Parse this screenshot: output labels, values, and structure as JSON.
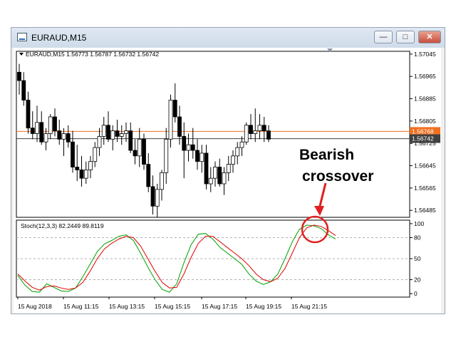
{
  "window": {
    "title": "EURAUD,M15",
    "min_glyph": "—",
    "max_glyph": "□",
    "close_glyph": "✕"
  },
  "chart_data": [
    {
      "type": "candlestick",
      "symbol_header": "EURAUD,M15  1.56773 1.56787 1.56732 1.56742",
      "ylim": [
        1.5646,
        1.57055
      ],
      "y_ticks": [
        "1.57045",
        "1.56965",
        "1.56885",
        "1.56805",
        "1.56725",
        "1.56645",
        "1.56565",
        "1.56485"
      ],
      "price_lines": [
        {
          "label": "1.56768",
          "value": 1.56768,
          "color": "#f07020"
        },
        {
          "label": "1.56742",
          "value": 1.56742,
          "color": "#404040"
        }
      ],
      "candle_colors": {
        "bull": "#ffffff",
        "bear": "#000000",
        "outline": "#000000"
      },
      "candles": [
        [
          1.5698,
          1.5701,
          1.569,
          1.5695
        ],
        [
          1.5695,
          1.5698,
          1.5686,
          1.5688
        ],
        [
          1.5688,
          1.5691,
          1.5676,
          1.5678
        ],
        [
          1.5678,
          1.5684,
          1.5674,
          1.5676
        ],
        [
          1.5676,
          1.5686,
          1.5673,
          1.568
        ],
        [
          1.568,
          1.5684,
          1.5672,
          1.5673
        ],
        [
          1.5673,
          1.5678,
          1.567,
          1.5676
        ],
        [
          1.5676,
          1.5683,
          1.5674,
          1.5682
        ],
        [
          1.5682,
          1.5685,
          1.5675,
          1.5677
        ],
        [
          1.5677,
          1.5681,
          1.5672,
          1.5674
        ],
        [
          1.5674,
          1.5678,
          1.5668,
          1.5676
        ],
        [
          1.5676,
          1.5679,
          1.5671,
          1.5673
        ],
        [
          1.5673,
          1.5677,
          1.5662,
          1.5664
        ],
        [
          1.5664,
          1.5672,
          1.5659,
          1.5663
        ],
        [
          1.5663,
          1.5668,
          1.5657,
          1.566
        ],
        [
          1.566,
          1.5666,
          1.5658,
          1.5663
        ],
        [
          1.5663,
          1.5668,
          1.566,
          1.5666
        ],
        [
          1.5666,
          1.5673,
          1.5664,
          1.5671
        ],
        [
          1.5671,
          1.5678,
          1.5668,
          1.5675
        ],
        [
          1.5675,
          1.5682,
          1.5672,
          1.5679
        ],
        [
          1.5679,
          1.5684,
          1.5673,
          1.5674
        ],
        [
          1.5674,
          1.5679,
          1.567,
          1.5677
        ],
        [
          1.5677,
          1.5681,
          1.5673,
          1.5675
        ],
        [
          1.5675,
          1.5679,
          1.5672,
          1.5676
        ],
        [
          1.5676,
          1.568,
          1.5673,
          1.5677
        ],
        [
          1.5677,
          1.568,
          1.5669,
          1.567
        ],
        [
          1.567,
          1.5674,
          1.5665,
          1.5668
        ],
        [
          1.5668,
          1.5678,
          1.5664,
          1.5674
        ],
        [
          1.5674,
          1.5676,
          1.5663,
          1.5665
        ],
        [
          1.5665,
          1.5669,
          1.5655,
          1.5657
        ],
        [
          1.5657,
          1.5661,
          1.5647,
          1.565
        ],
        [
          1.565,
          1.5658,
          1.5646,
          1.5656
        ],
        [
          1.5656,
          1.5663,
          1.5652,
          1.5662
        ],
        [
          1.5662,
          1.5678,
          1.5658,
          1.5674
        ],
        [
          1.5674,
          1.569,
          1.5671,
          1.5688
        ],
        [
          1.5688,
          1.5694,
          1.568,
          1.5682
        ],
        [
          1.5682,
          1.5686,
          1.5672,
          1.5675
        ],
        [
          1.5675,
          1.568,
          1.566,
          1.567
        ],
        [
          1.567,
          1.5676,
          1.5666,
          1.5672
        ],
        [
          1.5672,
          1.5678,
          1.5667,
          1.567
        ],
        [
          1.567,
          1.5674,
          1.5663,
          1.5666
        ],
        [
          1.5666,
          1.5672,
          1.5662,
          1.5669
        ],
        [
          1.5669,
          1.5672,
          1.5656,
          1.5658
        ],
        [
          1.5658,
          1.5664,
          1.5655,
          1.566
        ],
        [
          1.566,
          1.5666,
          1.5657,
          1.5664
        ],
        [
          1.5664,
          1.5667,
          1.5657,
          1.5658
        ],
        [
          1.5658,
          1.5664,
          1.5654,
          1.5662
        ],
        [
          1.5662,
          1.5668,
          1.5659,
          1.5665
        ],
        [
          1.5665,
          1.567,
          1.5662,
          1.5668
        ],
        [
          1.5668,
          1.5673,
          1.5665,
          1.5671
        ],
        [
          1.5671,
          1.5675,
          1.5668,
          1.5673
        ],
        [
          1.5673,
          1.568,
          1.5672,
          1.5679
        ],
        [
          1.5679,
          1.5683,
          1.5674,
          1.5676
        ],
        [
          1.5676,
          1.5685,
          1.5673,
          1.5677
        ],
        [
          1.5677,
          1.5683,
          1.5674,
          1.5679
        ],
        [
          1.5679,
          1.5682,
          1.5673,
          1.5677
        ],
        [
          1.5677,
          1.5679,
          1.5673,
          1.5674
        ]
      ],
      "annotation": [
        "Bearish",
        "crossover"
      ],
      "annotation_color": "#e02020"
    },
    {
      "type": "line",
      "title": "Stoch(12,3,3) 82.2449 89.8119",
      "ylim": [
        -5,
        105
      ],
      "y_ticks": [
        "100",
        "80",
        "50",
        "20",
        "0"
      ],
      "levels": [
        80,
        50,
        20
      ],
      "series": [
        {
          "color": "#00a000",
          "values": [
            26,
            12,
            3,
            2,
            14,
            9,
            4,
            3,
            8,
            24,
            42,
            60,
            71,
            76,
            82,
            84,
            76,
            58,
            38,
            20,
            6,
            2,
            14,
            44,
            70,
            85,
            86,
            78,
            66,
            58,
            50,
            42,
            28,
            18,
            13,
            17,
            28,
            50,
            74,
            92,
            98,
            97,
            93,
            84,
            78
          ]
        },
        {
          "color": "#e00000",
          "values": [
            28,
            18,
            9,
            5,
            10,
            11,
            8,
            6,
            8,
            16,
            32,
            50,
            64,
            72,
            78,
            82,
            80,
            68,
            50,
            32,
            16,
            8,
            9,
            28,
            52,
            72,
            82,
            82,
            74,
            66,
            58,
            50,
            40,
            28,
            20,
            17,
            22,
            36,
            58,
            80,
            94,
            98,
            96,
            90,
            83
          ]
        }
      ],
      "x_labels": [
        "15 Aug 2018",
        "15 Aug 11:15",
        "15 Aug 13:15",
        "15 Aug 15:15",
        "15 Aug 17:15",
        "15 Aug 19:15",
        "15 Aug 21:15"
      ]
    }
  ]
}
